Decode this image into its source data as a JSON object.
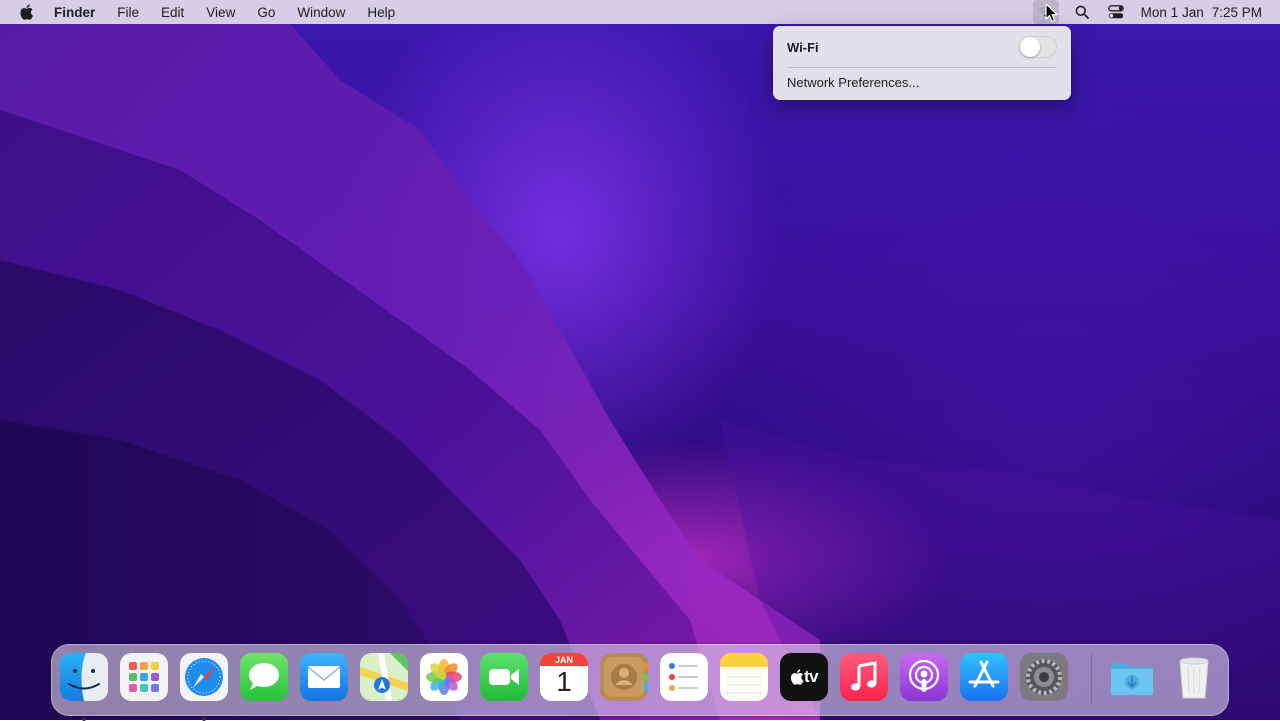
{
  "menubar": {
    "app_name": "Finder",
    "items": [
      "File",
      "Edit",
      "View",
      "Go",
      "Window",
      "Help"
    ],
    "clock_date": "Mon 1 Jan",
    "clock_time": "7:25 PM"
  },
  "wifi_menu": {
    "label": "Wi-Fi",
    "toggle_state": "off",
    "network_prefs": "Network Preferences..."
  },
  "dock": {
    "apps": [
      {
        "name": "Finder",
        "icon": "finder-icon",
        "running": true
      },
      {
        "name": "Launchpad",
        "icon": "launchpad-icon",
        "running": false
      },
      {
        "name": "Safari",
        "icon": "safari-icon",
        "running": true
      },
      {
        "name": "Messages",
        "icon": "messages-icon",
        "running": false
      },
      {
        "name": "Mail",
        "icon": "mail-icon",
        "running": false
      },
      {
        "name": "Maps",
        "icon": "maps-icon",
        "running": false
      },
      {
        "name": "Photos",
        "icon": "photos-icon",
        "running": false
      },
      {
        "name": "FaceTime",
        "icon": "facetime-icon",
        "running": false
      },
      {
        "name": "Calendar",
        "icon": "calendar-icon",
        "running": false
      },
      {
        "name": "Contacts",
        "icon": "contacts-icon",
        "running": false
      },
      {
        "name": "Reminders",
        "icon": "reminders-icon",
        "running": false
      },
      {
        "name": "Notes",
        "icon": "notes-icon",
        "running": false
      },
      {
        "name": "TV",
        "icon": "tv-icon",
        "running": false
      },
      {
        "name": "Music",
        "icon": "music-icon",
        "running": false
      },
      {
        "name": "Podcasts",
        "icon": "podcasts-icon",
        "running": false
      },
      {
        "name": "App Store",
        "icon": "app-store-icon",
        "running": false
      },
      {
        "name": "System Preferences",
        "icon": "system-preferences-icon",
        "running": false
      },
      {
        "name": "Downloads",
        "icon": "downloads-folder-icon",
        "running": false
      },
      {
        "name": "Trash",
        "icon": "trash-icon",
        "running": false
      }
    ],
    "calendar_month": "JAN",
    "calendar_day": "1",
    "tv_label": "tv"
  },
  "colors": {
    "menubar_bg": "#e4deec",
    "wallpaper_primary": "#3a0f9c",
    "wallpaper_highlight": "#aa28be"
  }
}
